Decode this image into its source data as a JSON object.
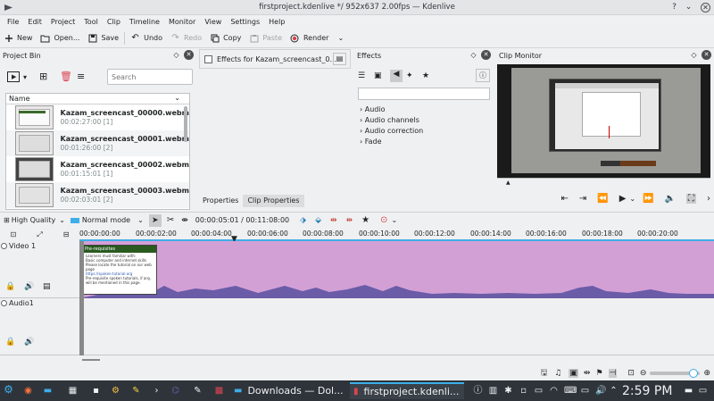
{
  "window": {
    "title": "firstproject.kdenlive */ 952x637 2.00fps — Kdenlive"
  },
  "menu": [
    "File",
    "Edit",
    "Project",
    "Tool",
    "Clip",
    "Timeline",
    "Monitor",
    "View",
    "Settings",
    "Help"
  ],
  "toolbar": {
    "new_label": "New",
    "open_label": "Open...",
    "save_label": "Save",
    "undo_label": "Undo",
    "redo_label": "Redo",
    "copy_label": "Copy",
    "paste_label": "Paste",
    "render_label": "Render"
  },
  "project_bin": {
    "title": "Project Bin",
    "search_placeholder": "Search",
    "column_name": "Name",
    "clips": [
      {
        "name": "Kazam_screencast_00000.webm",
        "duration": "00:02:27:00",
        "count": "[1]"
      },
      {
        "name": "Kazam_screencast_00001.webm",
        "duration": "00:01:26:00",
        "count": "[2]"
      },
      {
        "name": "Kazam_screencast_00002.webm",
        "duration": "00:01:15:01",
        "count": "[1]"
      },
      {
        "name": "Kazam_screencast_00003.webm",
        "duration": "00:02:03:01",
        "count": "[2]"
      }
    ]
  },
  "properties_panel": {
    "effects_for": "Effects for Kazam_screencast_0...",
    "tabs": [
      "Properties",
      "Clip Properties"
    ]
  },
  "effects_panel": {
    "title": "Effects",
    "categories": [
      "Audio",
      "Audio channels",
      "Audio correction",
      "Fade"
    ]
  },
  "clip_monitor": {
    "title": "Clip Monitor"
  },
  "timeline_toolbar": {
    "quality": "High Quality",
    "mode": "Normal mode",
    "timecode": "00:00:05:01 / 00:11:08:00"
  },
  "ruler_labels": [
    "00:00:00:00",
    "00:00:02:00",
    "00:00:04:00",
    "00:00:06:00",
    "00:00:08:00",
    "00:00:10:00",
    "00:00:12:00",
    "00:00:14:00",
    "00:00:16:00",
    "00:00:18:00",
    "00:00:20:00"
  ],
  "tracks": {
    "video1": "Video 1",
    "audio1": "Audio1",
    "clip_thumb_title": "Pre-requisites",
    "clip_thumb_lines": [
      "Learners must familiar with:",
      "Basic computer and internet skills",
      "Please locate the tutorial on our web page",
      "https://spoken-tutorial.org",
      "Pre-requisite spoken tutorials, if any, will be mentioned in this page."
    ]
  },
  "taskbar": {
    "tasks": [
      "Downloads — Dol...",
      "firstproject.kdenli..."
    ],
    "clock": "2:59 PM"
  },
  "colors": {
    "clip_purple": "#d3a0d6",
    "waveform": "#6b5ca8",
    "accent": "#3daee9",
    "taskbar": "#2f343b"
  }
}
